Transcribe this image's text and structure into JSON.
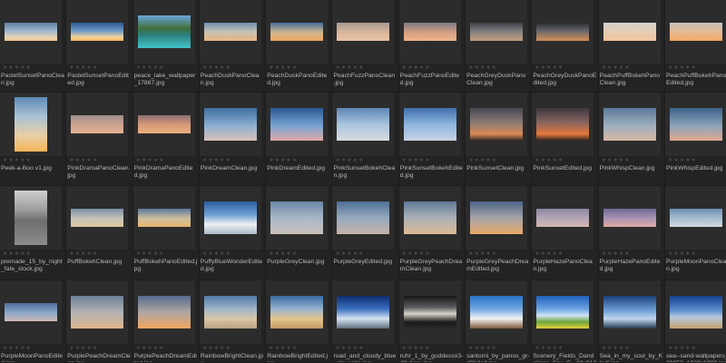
{
  "files": [
    {
      "name": "PastelSunsetPanoClean.jpg",
      "shape": "pano",
      "gradient": "linear-gradient(180deg,#5f7fa0 0%,#9db6cf 45%,#e7d3b4 80%,#f4c58c 100%)"
    },
    {
      "name": "PastelSunsetPanoEdited.jpg",
      "shape": "pano",
      "gradient": "linear-gradient(180deg,#2e5a93 0%,#6e97c8 45%,#f3d49a 80%,#f7b25a 100%)"
    },
    {
      "name": "peace_lake_wallpaper_17867.jpg",
      "shape": "landscape",
      "gradient": "linear-gradient(180deg,#6aa6d9 0%,#3f6f3a 40%,#2c7f7f 60%,#43c4c9 100%)"
    },
    {
      "name": "PeachDuskPanoClean.jpg",
      "shape": "pano",
      "gradient": "linear-gradient(180deg,#6d8fb0 0%,#c7c3b3 50%,#e6b583 100%)"
    },
    {
      "name": "PeachDuskPanoEdited.jpg",
      "shape": "pano",
      "gradient": "linear-gradient(180deg,#476d9b 0%,#cfb78f 55%,#f0a55b 100%)"
    },
    {
      "name": "PeachFuzzPanoClean .jpg",
      "shape": "pano",
      "gradient": "linear-gradient(180deg,#a69b92 0%,#d6b49b 50%,#e9c1a2 100%)"
    },
    {
      "name": "PeachFuzzPanoEdited.jpg",
      "shape": "pano",
      "gradient": "linear-gradient(180deg,#7e7a86 0%,#d59f82 55%,#efb48d 100%)"
    },
    {
      "name": "PeachGreyDuskPanoClean.jpg",
      "shape": "pano",
      "gradient": "linear-gradient(180deg,#3d4046 0%,#7c7c7d 45%,#c59e7c 100%)"
    },
    {
      "name": "PeachGreyDuskPanoEdited.jpg",
      "shape": "pano",
      "gradient": "linear-gradient(180deg,#292b31 0%,#6a666a 45%,#d58f5a 100%)"
    },
    {
      "name": "PeachPuffBokehPanoClean.jpg",
      "shape": "pano",
      "gradient": "linear-gradient(180deg,#d6d1cc 0%,#e7cdb3 55%,#f0c49c 100%)"
    },
    {
      "name": "PeachPuffBokehPanoEdited.jpg",
      "shape": "pano",
      "gradient": "linear-gradient(180deg,#c8c0bb 0%,#e8b98f 55%,#f3a865 100%)"
    },
    {
      "name": "Peek-a-Boo v1.jpg",
      "shape": "portrait",
      "gradient": "linear-gradient(180deg,#5d89b6 0%,#a9c1d3 35%,#e8cfa7 70%,#f6b458 100%)"
    },
    {
      "name": "PinkDramaPanoClean.jpg",
      "shape": "pano",
      "gradient": "linear-gradient(180deg,#9e8d8f 0%,#cda38f 50%,#e1b293 100%)"
    },
    {
      "name": "PinkDramaPanoEdited.jpg",
      "shape": "pano",
      "gradient": "linear-gradient(180deg,#8a6f72 0%,#d59879 50%,#eeb07f 100%)"
    },
    {
      "name": "PinkDreamClean.jpg",
      "shape": "landscape",
      "gradient": "linear-gradient(180deg,#3f6d9f 0%,#8cb0d2 55%,#d9c2b8 100%)"
    },
    {
      "name": "PinkDreamEdited.jpg",
      "shape": "landscape",
      "gradient": "linear-gradient(180deg,#2a5792 0%,#7aa4d2 55%,#e0a9a6 100%)"
    },
    {
      "name": "PinkSunsetBokehClean.jpg",
      "shape": "landscape",
      "gradient": "linear-gradient(180deg,#5e87b6 0%,#a9c4de 50%,#d7dbe0 100%)"
    },
    {
      "name": "PinkSunsetBokehEdited.jpg",
      "shape": "landscape",
      "gradient": "linear-gradient(180deg,#3e6eab 0%,#8fb5e0 50%,#c8d2e4 100%)"
    },
    {
      "name": "PinkSunsetClean.jpg",
      "shape": "landscape",
      "gradient": "linear-gradient(180deg,#464750 0%,#8b7c76 45%,#d98a55 80%,#2f2a28 100%)"
    },
    {
      "name": "PinkSunsetEdited.jpg",
      "shape": "landscape",
      "gradient": "linear-gradient(180deg,#3c3840 0%,#8a6660 45%,#e4773a 80%,#2a2221 100%)"
    },
    {
      "name": "PinkWhispClean.jpg",
      "shape": "landscape",
      "gradient": "linear-gradient(180deg,#5a7a9a 0%,#9fb0c0 55%,#d6b7a5 100%)"
    },
    {
      "name": "PinkWhispEdited.jpg",
      "shape": "landscape",
      "gradient": "linear-gradient(180deg,#3d6189 0%,#8ea3bb 55%,#e0ab8f 100%)"
    },
    {
      "name": "premade_15_by_night_fate_stock.jpg",
      "shape": "portrait",
      "gradient": "linear-gradient(180deg,#cfcfcf 0%,#9d9d9d 35%,#6e6e6e 55%,#8c8c8c 100%)"
    },
    {
      "name": "PuffBokehClean.jpg",
      "shape": "pano",
      "gradient": "linear-gradient(180deg,#7a8fa8 0%,#c8c4b6 55%,#dbc59d 100%)"
    },
    {
      "name": "PuffBokehPanoEdited.jpg",
      "shape": "pano",
      "gradient": "linear-gradient(180deg,#5d7a9c 0%,#cfbf9c 55%,#e8b46f 100%)"
    },
    {
      "name": "PuffyBlueWonderEdited.jpg",
      "shape": "landscape",
      "gradient": "linear-gradient(180deg,#2d5fa0 0%,#6f9fd3 40%,#eef0f2 70%,#a9b8c7 100%)"
    },
    {
      "name": "PurpleGreyClean.jpg",
      "shape": "landscape",
      "gradient": "linear-gradient(180deg,#6a87a6 0%,#a7b8c8 50%,#c9c0bb 100%)"
    },
    {
      "name": "PurpleGreyEdited.jpg",
      "shape": "landscape",
      "gradient": "linear-gradient(180deg,#4d6f96 0%,#96a9bf 50%,#c7b3ab 100%)"
    },
    {
      "name": "PurpleGreyPeachDreamClean.jpg",
      "shape": "landscape",
      "gradient": "linear-gradient(180deg,#5f7897 0%,#aab1b7 50%,#dfb995 100%)"
    },
    {
      "name": "PurpleGreyPeachDreamEdited.jpg",
      "shape": "landscape",
      "gradient": "linear-gradient(180deg,#4b6487 0%,#a4a3a6 50%,#eaa96a 100%)"
    },
    {
      "name": "PurpleHazePanoClean.jpg",
      "shape": "pano",
      "gradient": "linear-gradient(180deg,#8a86a0 0%,#b6a8b8 55%,#d4b6b2 100%)"
    },
    {
      "name": "PurpleHazePanoEdited.jpg",
      "shape": "pano",
      "gradient": "linear-gradient(180deg,#6d6795 0%,#ab95b5 55%,#e3a9a0 100%)"
    },
    {
      "name": "PurpleMoonPanoClean.jpg",
      "shape": "pano",
      "gradient": "linear-gradient(180deg,#6f8fb0 0%,#a9bfd2 55%,#cfd8e0 100%)"
    },
    {
      "name": "PurpleMoonPanoEdited.jpg",
      "shape": "pano",
      "gradient": "linear-gradient(180deg,#4d6f9d 0%,#8da9c8 55%,#d3b7b2 100%)"
    },
    {
      "name": "PurplePeachDreamClean.jpg",
      "shape": "landscape",
      "gradient": "linear-gradient(180deg,#6b7f98 0%,#b3b3b3 50%,#dfb68f 100%)"
    },
    {
      "name": "PurplePeachDreamEdited.jpg",
      "shape": "landscape",
      "gradient": "linear-gradient(180deg,#566a8c 0%,#b0a6a3 50%,#f0a65e 100%)"
    },
    {
      "name": "RainbowBrightClean.jpg",
      "shape": "landscape",
      "gradient": "linear-gradient(180deg,#4f78a5 0%,#9fb5c8 40%,#d8c6a8 70%,#b9a182 100%)"
    },
    {
      "name": "RainbowBrightEdited.jpg",
      "shape": "landscape",
      "gradient": "linear-gradient(180deg,#3a6aa3 0%,#95b2cd 40%,#e6c58f 70%,#c29a64 100%)"
    },
    {
      "name": "road_and_cloudy_blue_sky-wide.jpg",
      "shape": "landscape",
      "gradient": "linear-gradient(180deg,#0f2d6e 0%,#3a6fc0 40%,#d7e3f2 70%,#5d6f7d 100%)"
    },
    {
      "name": "ruhr_1_by_goddessx3-d2y1srx.jpg",
      "shape": "landscape",
      "gradient": "linear-gradient(180deg,#151515 0%,#5b5a5f 35%,#d6d2c8 55%,#1b1b1b 80%,#2a2a2a 100%)"
    },
    {
      "name": "santorni_by_panos_gr-d3lr4q4.jpg",
      "shape": "landscape",
      "gradient": "linear-gradient(180deg,#2a73c8 0%,#6fa8e0 40%,#f2f2f2 70%,#7a5a3a 100%)"
    },
    {
      "name": "Scenery_Fields_Dandelions_Sky_G...00x3120.jpg",
      "shape": "landscape",
      "gradient": "linear-gradient(180deg,#1f5fba 0%,#6ca3e2 40%,#cfe4f7 60%,#6ea53a 80%,#e5d13b 100%)"
    },
    {
      "name": "Sea_in_my_soul_by_Klodi.jpg",
      "shape": "landscape",
      "gradient": "linear-gradient(180deg,#1b3f7a 0%,#6f9fd6 45%,#c0d7ee 70%,#233a4f 100%)"
    },
    {
      "name": "sea--sand-wallpapers_29253_1920x1080.jpg",
      "shape": "landscape",
      "gradient": "linear-gradient(180deg,#15418c 0%,#5d8fd0 45%,#b7c8dd 65%,#c4a26f 100%)"
    }
  ],
  "rating": "★★★★★"
}
